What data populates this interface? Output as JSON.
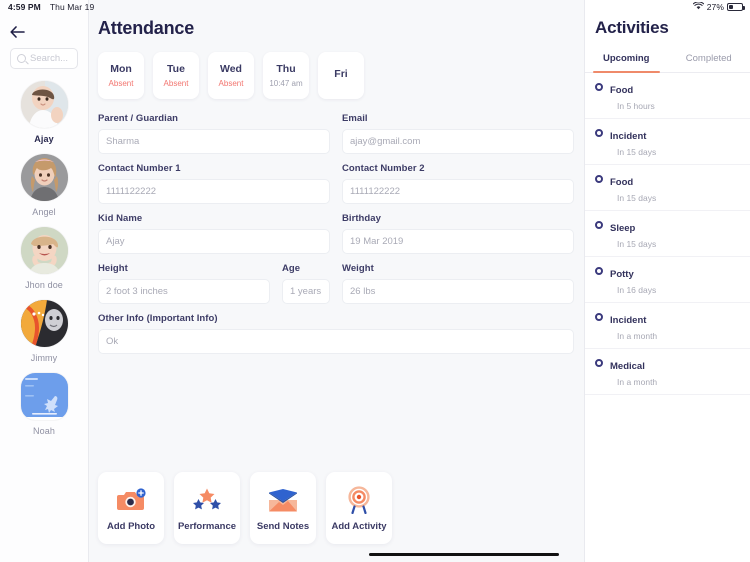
{
  "status_bar": {
    "time": "4:59 PM",
    "date": "Thu Mar 19",
    "battery_percent": "27%",
    "wifi_icon": "wifi-icon",
    "battery_icon": "battery-icon"
  },
  "rail": {
    "back_icon": "back-arrow-icon",
    "search": {
      "placeholder": "Search...",
      "value": "",
      "icon": "search-icon"
    },
    "kids": [
      {
        "name": "Ajay",
        "active": true,
        "avatar": "avatar-ajay"
      },
      {
        "name": "Angel",
        "active": false,
        "avatar": "avatar-angel"
      },
      {
        "name": "Jhon doe",
        "active": false,
        "avatar": "avatar-jhon-doe"
      },
      {
        "name": "Jimmy",
        "active": false,
        "avatar": "avatar-jimmy"
      },
      {
        "name": "Noah",
        "active": false,
        "avatar": "avatar-noah"
      }
    ]
  },
  "main": {
    "title": "Attendance",
    "days": [
      {
        "day": "Mon",
        "status": "Absent",
        "is_time": false
      },
      {
        "day": "Tue",
        "status": "Absent",
        "is_time": false
      },
      {
        "day": "Wed",
        "status": "Absent",
        "is_time": false
      },
      {
        "day": "Thu",
        "status": "10:47 am",
        "is_time": true
      },
      {
        "day": "Fri",
        "status": "",
        "is_time": false
      }
    ],
    "fields": {
      "parent_guardian": {
        "label": "Parent / Guardian",
        "value": "Sharma"
      },
      "email": {
        "label": "Email",
        "value": "ajay@gmail.com"
      },
      "contact1": {
        "label": "Contact Number 1",
        "value": "1111122222"
      },
      "contact2": {
        "label": "Contact Number 2",
        "value": "1111122222"
      },
      "kid_name": {
        "label": "Kid Name",
        "value": "Ajay"
      },
      "birthday": {
        "label": "Birthday",
        "value": "19 Mar 2019"
      },
      "height": {
        "label": "Height",
        "value": "2 foot 3 inches"
      },
      "age": {
        "label": "Age",
        "value": "1 years"
      },
      "weight": {
        "label": "Weight",
        "value": "26 lbs"
      },
      "other_info": {
        "label": "Other Info (Important Info)",
        "value": "Ok"
      }
    },
    "actions": [
      {
        "label": "Add Photo",
        "icon": "camera-add-icon"
      },
      {
        "label": "Performance",
        "icon": "stars-icon"
      },
      {
        "label": "Send Notes",
        "icon": "envelope-photo-icon"
      },
      {
        "label": "Add Activity",
        "icon": "target-icon"
      }
    ]
  },
  "right_panel": {
    "title": "Activities",
    "tabs": [
      {
        "label": "Upcoming",
        "active": true
      },
      {
        "label": "Completed",
        "active": false
      }
    ],
    "activities": [
      {
        "name": "Food",
        "when": "In 5 hours"
      },
      {
        "name": "Incident",
        "when": "In 15 days"
      },
      {
        "name": "Food",
        "when": "In 15 days"
      },
      {
        "name": "Sleep",
        "when": "In 15 days"
      },
      {
        "name": "Potty",
        "when": "In 16 days"
      },
      {
        "name": "Incident",
        "when": "In a month"
      },
      {
        "name": "Medical",
        "when": "In a month"
      }
    ]
  },
  "colors": {
    "accent_orange": "#ef8a6a",
    "accent_red": "#f2756f",
    "navy": "#23224a",
    "indigo": "#3b3a7d",
    "blue": "#3b5fc0",
    "bg": "#f7f8fa"
  }
}
